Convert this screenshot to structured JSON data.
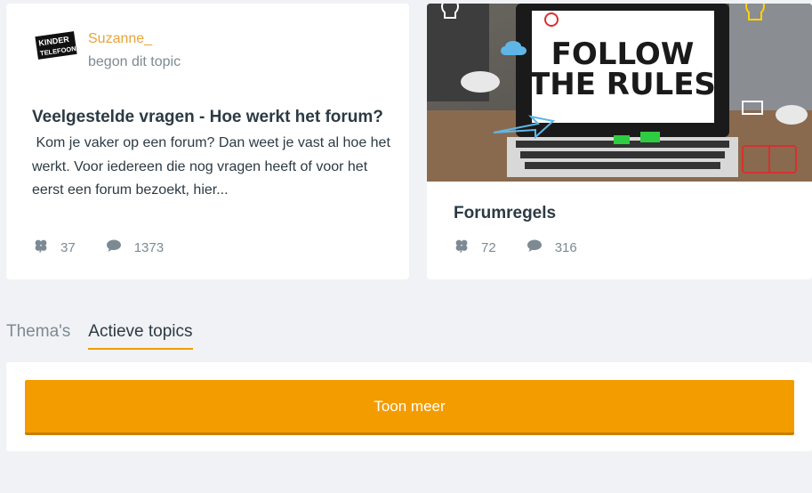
{
  "topics": [
    {
      "author": "Suzanne_",
      "action": "begon dit topic",
      "logo_label": "DE KINDER TELEFOON",
      "title": "Veelgestelde vragen - Hoe werkt het forum?",
      "excerpt": " Kom je vaker op een forum? Dan weet je vast al hoe het werkt. Voor iedereen die nog vragen heeft of voor het eerst een forum bezoekt, hier...",
      "likes": "37",
      "replies": "1373"
    },
    {
      "image_text_line1": "FOLLOW",
      "image_text_line2": "THE RULES",
      "title": "Forumregels",
      "likes": "72",
      "replies": "316"
    }
  ],
  "tabs": [
    {
      "label": "Thema's",
      "active": false
    },
    {
      "label": "Actieve topics",
      "active": true
    }
  ],
  "more_button": "Toon meer",
  "icons": {
    "like": "clover-icon",
    "reply": "speech-bubble-icon"
  },
  "colors": {
    "accent": "#f39c00",
    "author": "#e9a33a",
    "text": "#2c3a44",
    "muted": "#7d8a93"
  }
}
